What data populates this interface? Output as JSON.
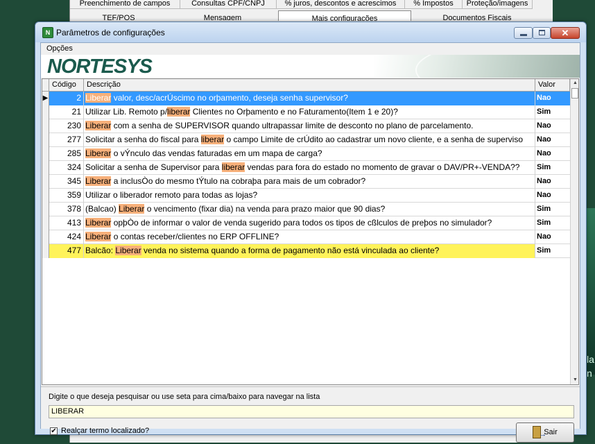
{
  "background": {
    "tabs_row1": [
      "Preenchimento de campos",
      "Consultas CPF/CNPJ",
      "% juros, descontos e acrescimos",
      "% Impostos",
      "Proteção/imagens"
    ],
    "tabs_row2": [
      "TEF/POS",
      "Mensagem",
      "Mais configurações",
      "Documentos Fiscais"
    ],
    "right_texts": [
      "la",
      "n"
    ]
  },
  "window": {
    "title": "Parâmetros de configurações",
    "icon": "app-logo-icon",
    "close_glyph": "✕"
  },
  "menu": {
    "items": [
      "Opções"
    ]
  },
  "banner": {
    "logo_text": "NORTESYS"
  },
  "grid": {
    "columns": [
      "Código",
      "Descrição",
      "Valor"
    ],
    "rows": [
      {
        "code": "2",
        "segs": [
          "",
          "Liberar",
          " valor, desc/acrÚscimo no orþamento, deseja senha supervisor?"
        ],
        "value": "Nao"
      },
      {
        "code": "21",
        "segs": [
          "Utilizar Lib. Remoto p/",
          "liberar",
          " Clientes no Orþamento e no Faturamento(Item 1 e 20)?"
        ],
        "value": "Sim"
      },
      {
        "code": "230",
        "segs": [
          "",
          "Liberar",
          " com a senha de SUPERVISOR quando ultrapassar limite de desconto no plano de parcelamento."
        ],
        "value": "Nao"
      },
      {
        "code": "277",
        "segs": [
          "Solicitar a senha do fiscal para ",
          "liberar",
          " o campo Limite de crÚdito ao cadastrar um novo cliente, e a senha de superviso"
        ],
        "value": "Nao"
      },
      {
        "code": "285",
        "segs": [
          "",
          "Liberar",
          " o vÝnculo das vendas faturadas em um mapa de carga?"
        ],
        "value": "Nao"
      },
      {
        "code": "324",
        "segs": [
          "Solicitar a senha de Supervisor para ",
          "liberar",
          " vendas para fora do estado no momento de gravar o DAV/PR+-VENDA??"
        ],
        "value": "Sim"
      },
      {
        "code": "345",
        "segs": [
          "",
          "Liberar",
          " a inclusÒo do mesmo tÝtulo na cobraþa para mais de um cobrador?"
        ],
        "value": "Nao"
      },
      {
        "code": "359",
        "segs": [
          "Utilizar o liberador remoto para todas as lojas?",
          "",
          ""
        ],
        "value": "Nao"
      },
      {
        "code": "378",
        "segs": [
          "(Balcao) ",
          "Liberar",
          " o vencimento (fixar dia) na venda para prazo maior que 90 dias?"
        ],
        "value": "Sim"
      },
      {
        "code": "413",
        "segs": [
          "",
          "Liberar",
          " opþÒo de informar o valor de venda sugerido para todos os tipos de cßlculos de preþos no simulador?"
        ],
        "value": "Sim"
      },
      {
        "code": "424",
        "segs": [
          "",
          "Liberar",
          " o contas receber/clientes no ERP OFFLINE?"
        ],
        "value": "Nao"
      },
      {
        "code": "477",
        "segs": [
          "Balcão: ",
          "Liberar",
          " venda no sistema quando a forma de pagamento não está vinculada ao cliente?"
        ],
        "value": "Sim"
      }
    ],
    "current_row_indicator": "▶"
  },
  "search": {
    "hint": "Digite o que deseja pesquisar ou use seta para cima/baixo para navegar na lista",
    "value": "LIBERAR",
    "highlight_checkbox_label": "Realçar termo localizado?",
    "highlight_checked": true,
    "exit_button_label": "Sair"
  }
}
